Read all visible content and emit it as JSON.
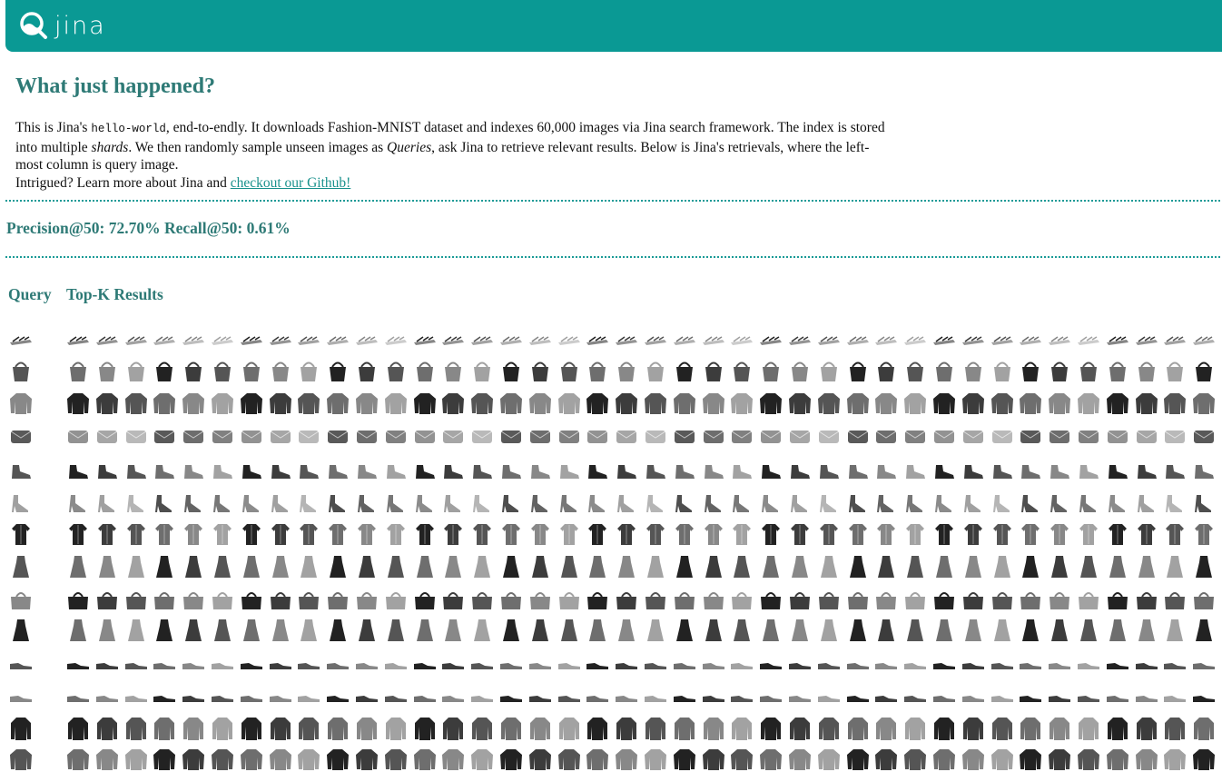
{
  "header": {
    "logo_text": "jina",
    "bg_color": "#0a9994"
  },
  "headline": "What just happened?",
  "intro": {
    "part1": "This is Jina's ",
    "code": "hello-world",
    "part2": ", end-to-endly. It downloads Fashion-MNIST dataset and indexes 60,000 images via Jina search framework. The index is stored into multiple ",
    "shards": "shards",
    "part3": ". We then randomly sample unseen images as ",
    "queries": "Queries",
    "part4": ", ask Jina to retrieve relevant results. Below is Jina's retrievals, where the left-most column is query image.",
    "part5": "Intrigued? Learn more about Jina and ",
    "link": "checkout our Github!"
  },
  "metrics": {
    "precision_label": "Precision@50:",
    "precision_value": "72.70%",
    "recall_label": "Recall@50:",
    "recall_value": "0.61%"
  },
  "columns": {
    "query": "Query",
    "results": "Top-K Results"
  },
  "results": {
    "rows": [
      {
        "query": "sandal",
        "items": "sandal"
      },
      {
        "query": "tote-bag",
        "items": "tote-bag"
      },
      {
        "query": "pullover",
        "items": "pullover"
      },
      {
        "query": "clutch-bag",
        "items": "clutch-bag"
      },
      {
        "query": "ankle-boot",
        "items": "ankle-boot"
      },
      {
        "query": "heeled-sandal",
        "items": "heeled-sandal"
      },
      {
        "query": "shirt",
        "items": "shirt"
      },
      {
        "query": "dress",
        "items": "dress"
      },
      {
        "query": "handbag",
        "items": "handbag"
      },
      {
        "query": "dress",
        "items": "dress"
      },
      {
        "query": "sneaker",
        "items": "sneaker"
      },
      {
        "query": "sneaker",
        "items": "sneaker"
      },
      {
        "query": "coat",
        "items": "coat"
      },
      {
        "query": "pullover",
        "items": "pullover"
      }
    ],
    "results_per_row": 40,
    "colors": [
      "#222222",
      "#3c3c3c",
      "#555555",
      "#6e6e6e",
      "#888888",
      "#a2a2a2"
    ]
  }
}
